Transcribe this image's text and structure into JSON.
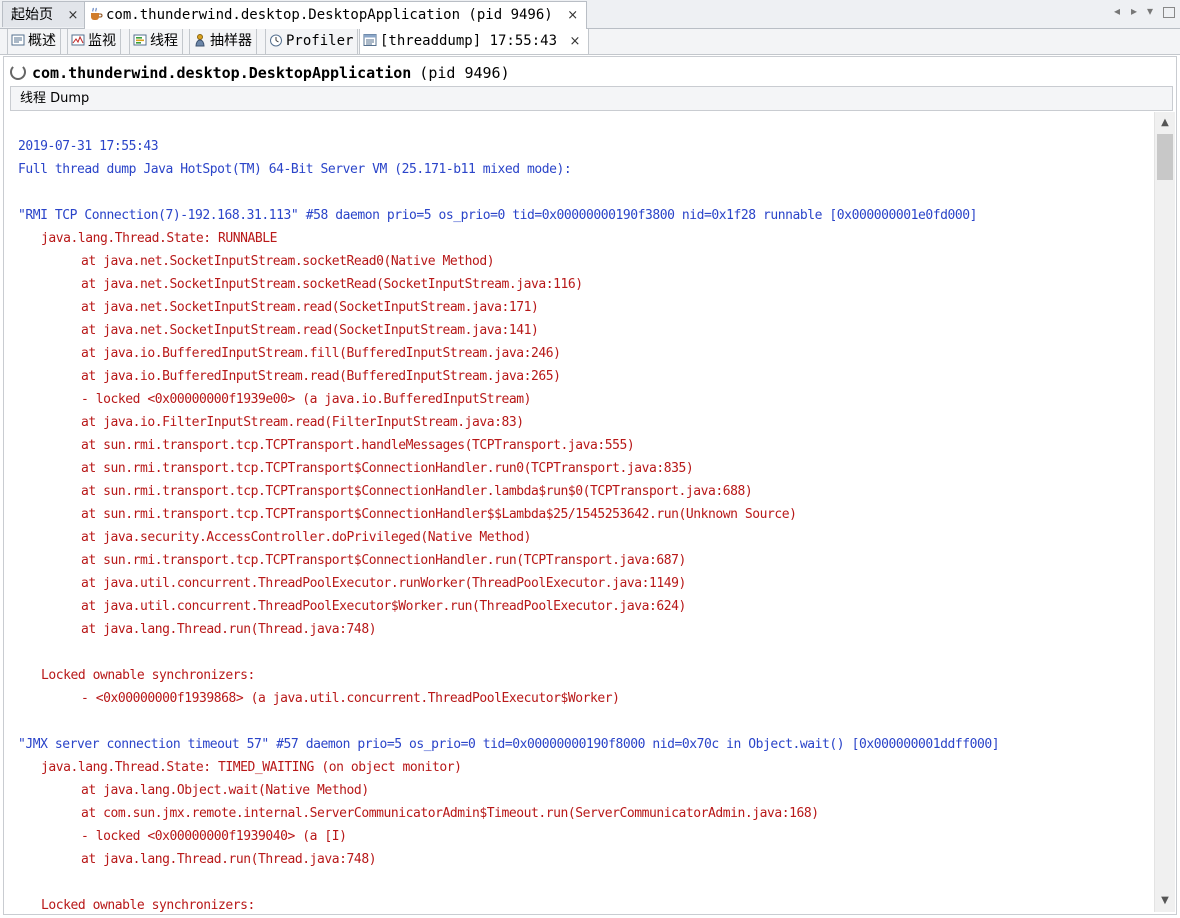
{
  "doc_tabs": [
    {
      "label": "起始页",
      "close": "×"
    },
    {
      "label": "com.thunderwind.desktop.DesktopApplication (pid 9496)",
      "close": "×"
    }
  ],
  "window_controls": {
    "prev": "◂",
    "next": "▸",
    "menu": "▾"
  },
  "view_tabs": [
    {
      "label": "概述",
      "icon": "overview-icon"
    },
    {
      "label": "监视",
      "icon": "monitor-icon"
    },
    {
      "label": "线程",
      "icon": "threads-icon"
    },
    {
      "label": "抽样器",
      "icon": "sampler-icon"
    },
    {
      "label": "Profiler",
      "icon": "profiler-icon"
    },
    {
      "label": "[threaddump] 17:55:43",
      "icon": "threaddump-icon",
      "close": "×"
    }
  ],
  "header": {
    "app_name": "com.thunderwind.desktop.DesktopApplication",
    "pid": "(pid 9496)"
  },
  "section": {
    "title": "线程 Dump"
  },
  "dump_lines": [
    {
      "text": "2019-07-31 17:55:43",
      "color": "blue",
      "indent": 0
    },
    {
      "text": "Full thread dump Java HotSpot(TM) 64-Bit Server VM (25.171-b11 mixed mode):",
      "color": "blue",
      "indent": 0
    },
    {
      "text": "",
      "color": "blue",
      "indent": 0
    },
    {
      "text": "\"RMI TCP Connection(7)-192.168.31.113\" #58 daemon prio=5 os_prio=0 tid=0x00000000190f3800 nid=0x1f28 runnable [0x000000001e0fd000]",
      "color": "blue",
      "indent": 0
    },
    {
      "text": "java.lang.Thread.State: RUNNABLE",
      "color": "red",
      "indent": 1
    },
    {
      "text": "at java.net.SocketInputStream.socketRead0(Native Method)",
      "color": "red",
      "indent": 2
    },
    {
      "text": "at java.net.SocketInputStream.socketRead(SocketInputStream.java:116)",
      "color": "red",
      "indent": 2
    },
    {
      "text": "at java.net.SocketInputStream.read(SocketInputStream.java:171)",
      "color": "red",
      "indent": 2
    },
    {
      "text": "at java.net.SocketInputStream.read(SocketInputStream.java:141)",
      "color": "red",
      "indent": 2
    },
    {
      "text": "at java.io.BufferedInputStream.fill(BufferedInputStream.java:246)",
      "color": "red",
      "indent": 2
    },
    {
      "text": "at java.io.BufferedInputStream.read(BufferedInputStream.java:265)",
      "color": "red",
      "indent": 2
    },
    {
      "text": "- locked <0x00000000f1939e00> (a java.io.BufferedInputStream)",
      "color": "red",
      "indent": 2
    },
    {
      "text": "at java.io.FilterInputStream.read(FilterInputStream.java:83)",
      "color": "red",
      "indent": 2
    },
    {
      "text": "at sun.rmi.transport.tcp.TCPTransport.handleMessages(TCPTransport.java:555)",
      "color": "red",
      "indent": 2
    },
    {
      "text": "at sun.rmi.transport.tcp.TCPTransport$ConnectionHandler.run0(TCPTransport.java:835)",
      "color": "red",
      "indent": 2
    },
    {
      "text": "at sun.rmi.transport.tcp.TCPTransport$ConnectionHandler.lambda$run$0(TCPTransport.java:688)",
      "color": "red",
      "indent": 2
    },
    {
      "text": "at sun.rmi.transport.tcp.TCPTransport$ConnectionHandler$$Lambda$25/1545253642.run(Unknown Source)",
      "color": "red",
      "indent": 2
    },
    {
      "text": "at java.security.AccessController.doPrivileged(Native Method)",
      "color": "red",
      "indent": 2
    },
    {
      "text": "at sun.rmi.transport.tcp.TCPTransport$ConnectionHandler.run(TCPTransport.java:687)",
      "color": "red",
      "indent": 2
    },
    {
      "text": "at java.util.concurrent.ThreadPoolExecutor.runWorker(ThreadPoolExecutor.java:1149)",
      "color": "red",
      "indent": 2
    },
    {
      "text": "at java.util.concurrent.ThreadPoolExecutor$Worker.run(ThreadPoolExecutor.java:624)",
      "color": "red",
      "indent": 2
    },
    {
      "text": "at java.lang.Thread.run(Thread.java:748)",
      "color": "red",
      "indent": 2
    },
    {
      "text": "",
      "color": "red",
      "indent": 0
    },
    {
      "text": "Locked ownable synchronizers:",
      "color": "red",
      "indent": 1
    },
    {
      "text": "- <0x00000000f1939868> (a java.util.concurrent.ThreadPoolExecutor$Worker)",
      "color": "red",
      "indent": 2
    },
    {
      "text": "",
      "color": "red",
      "indent": 0
    },
    {
      "text": "\"JMX server connection timeout 57\" #57 daemon prio=5 os_prio=0 tid=0x00000000190f8000 nid=0x70c in Object.wait() [0x000000001ddff000]",
      "color": "blue",
      "indent": 0
    },
    {
      "text": "java.lang.Thread.State: TIMED_WAITING (on object monitor)",
      "color": "red",
      "indent": 1
    },
    {
      "text": "at java.lang.Object.wait(Native Method)",
      "color": "red",
      "indent": 2
    },
    {
      "text": "at com.sun.jmx.remote.internal.ServerCommunicatorAdmin$Timeout.run(ServerCommunicatorAdmin.java:168)",
      "color": "red",
      "indent": 2
    },
    {
      "text": "- locked <0x00000000f1939040> (a [I)",
      "color": "red",
      "indent": 2
    },
    {
      "text": "at java.lang.Thread.run(Thread.java:748)",
      "color": "red",
      "indent": 2
    },
    {
      "text": "",
      "color": "red",
      "indent": 0
    },
    {
      "text": "Locked ownable synchronizers:",
      "color": "red",
      "indent": 1
    }
  ],
  "colors": {
    "blue": "#2a44c9",
    "red": "#b81818"
  }
}
